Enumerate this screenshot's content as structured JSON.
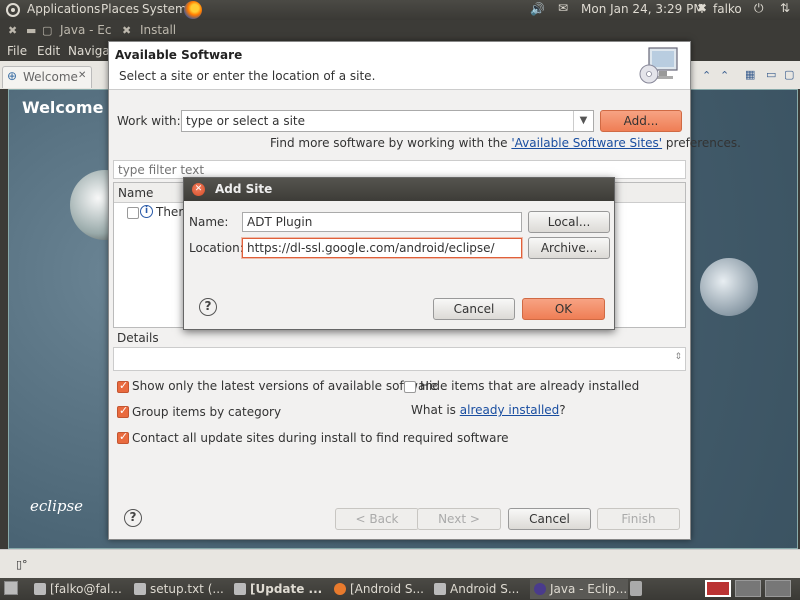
{
  "top_panel": {
    "menus": [
      "Applications",
      "Places",
      "System"
    ],
    "datetime": "Mon Jan 24,  3:29 PM",
    "user": "falko"
  },
  "eclipse": {
    "window_title": "Java - Ec",
    "window_title_extra": "Install",
    "menu": [
      "File",
      "Edit",
      "Navigat"
    ],
    "welcome_tab": "Welcome",
    "welcome_heading": "Welcome to",
    "logo_text": "eclipse"
  },
  "available": {
    "title": "Available Software",
    "subtitle": "Select a site or enter the location of a site.",
    "work_with_label": "Work with:",
    "work_with_placeholder": "type or select a site",
    "add_button": "Add...",
    "find_more_prefix": "Find more software by working with the ",
    "find_more_link": "'Available Software Sites'",
    "find_more_suffix": " preferences.",
    "filter_placeholder": "type filter text",
    "column_name": "Name",
    "tree_item": "There",
    "details_label": "Details",
    "options": {
      "show_latest": "Show only the latest versions of available software",
      "hide_installed": "Hide items that are already installed",
      "group_by_category": "Group items by category",
      "what_is_prefix": "What is ",
      "what_is_link": "already installed",
      "what_is_suffix": "?",
      "contact_sites": "Contact all update sites during install to find required software"
    },
    "buttons": {
      "back": "< Back",
      "next": "Next >",
      "cancel": "Cancel",
      "finish": "Finish"
    }
  },
  "add_site": {
    "title": "Add Site",
    "name_label": "Name:",
    "name_value": "ADT Plugin",
    "location_label": "Location:",
    "location_value": "https://dl-ssl.google.com/android/eclipse/",
    "local_button": "Local...",
    "archive_button": "Archive...",
    "cancel_button": "Cancel",
    "ok_button": "OK"
  },
  "taskbar": {
    "tasks": [
      "[falko@fal...",
      "setup.txt (...",
      "[Update ...",
      "[Android S...",
      "Android S...",
      "Java - Eclip..."
    ]
  }
}
